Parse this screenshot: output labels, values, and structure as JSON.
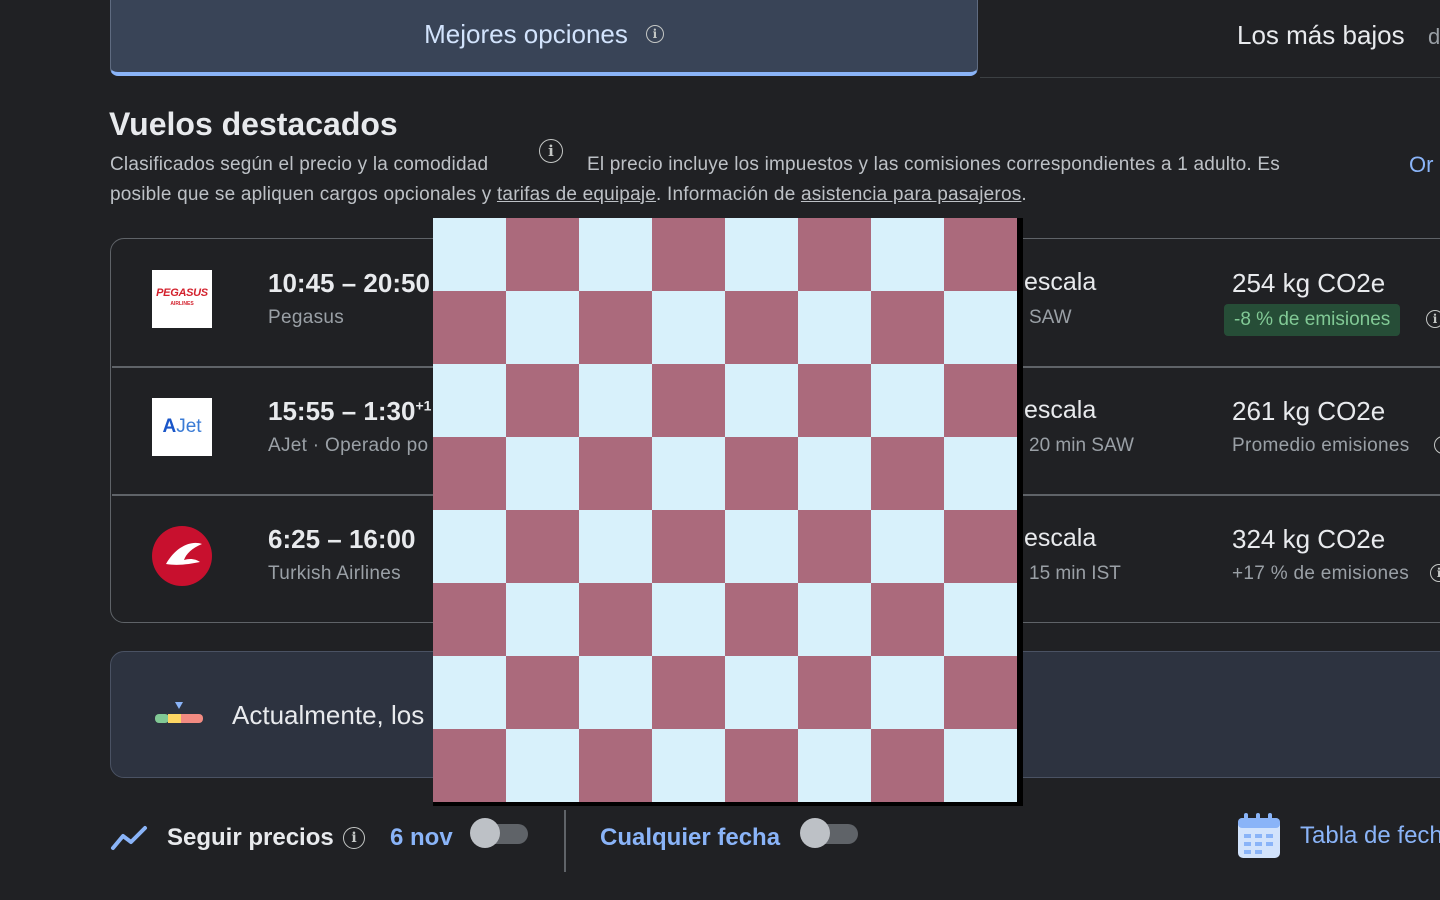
{
  "tabs": {
    "best": "Mejores opciones",
    "lowest": "Los más bajos",
    "lowest_extra": "d"
  },
  "section": {
    "title": "Vuelos destacados",
    "ranked_by": "Clasificados según el precio y la comodidad",
    "price_note_1": "El precio incluye los impuestos y las comisiones correspondientes a 1 adulto. Es",
    "price_note_2a": "posible que se apliquen cargos opcionales y ",
    "baggage_link": "tarifas de equipaje",
    "price_note_2b": ". Información de ",
    "assistance_link": "asistencia para pasajeros",
    "price_note_2c": ".",
    "sort_link": "Or"
  },
  "flights": [
    {
      "time": "10:45 – 20:50",
      "airline": "Pegasus",
      "logo_text": "PEGASUS",
      "logo_sub": "AIRLINES",
      "stops": "escala",
      "stop_detail": "SAW",
      "emissions": "254 kg CO2e",
      "emissions_note": "-8 % de emisiones"
    },
    {
      "time": "15:55 – 1:30",
      "time_sup": "+1",
      "airline": "AJet · Operado po",
      "logo_a": "A",
      "logo_jet": "Jet",
      "stops": "escala",
      "stop_detail": "20 min SAW",
      "emissions": "261 kg CO2e",
      "emissions_note": "Promedio emisiones"
    },
    {
      "time": "6:25 – 16:00",
      "airline": "Turkish Airlines",
      "stops": "escala",
      "stop_detail": "15 min IST",
      "emissions": "324 kg CO2e",
      "emissions_note": "+17 % de emisiones"
    }
  ],
  "banner": {
    "text": "Actualmente, los"
  },
  "bottom": {
    "track_label": "Seguir precios",
    "date": "6 nov",
    "any_date": "Cualquier fecha",
    "calendar_link": "Tabla de fech"
  },
  "colors": {
    "accent": "#8ab4f8",
    "background": "#202124",
    "emission_badge_bg": "#264d37",
    "emission_badge_text": "#81c995",
    "checker_light": "#d8f1fb",
    "checker_dark": "#ab6a7c"
  },
  "icons": [
    "info-icon",
    "price-tracking-icon",
    "calendar-icon",
    "price-insight-icon"
  ]
}
